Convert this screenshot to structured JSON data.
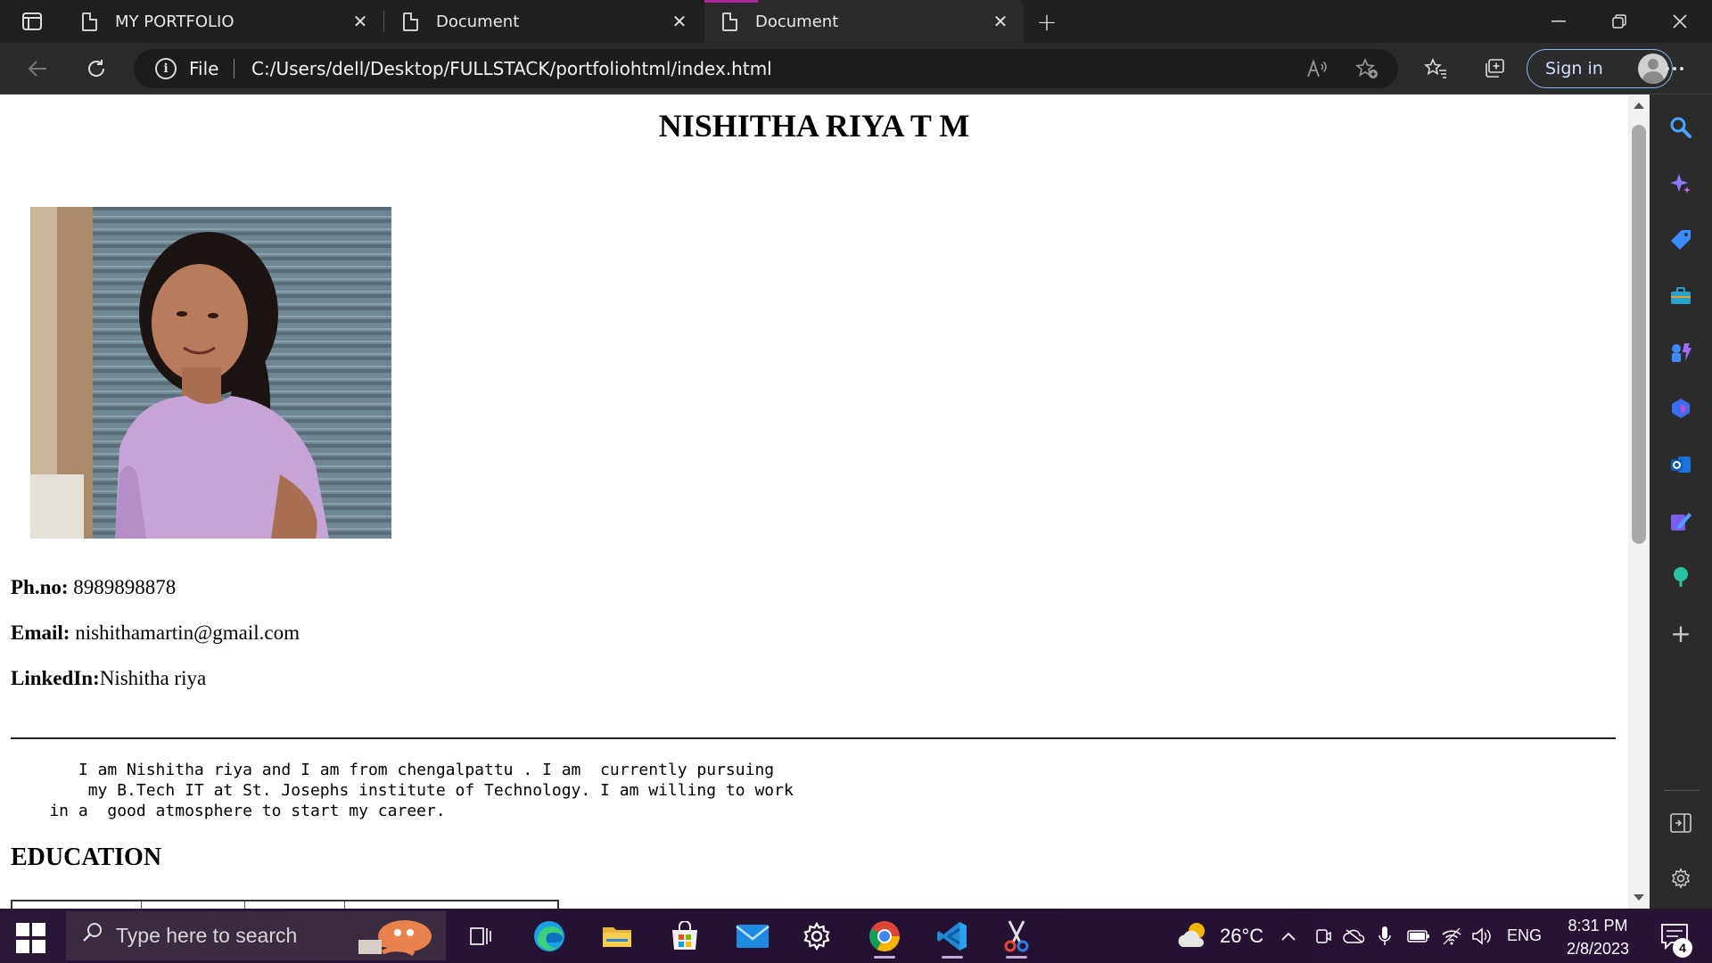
{
  "browser": {
    "tabs": [
      {
        "label": "MY PORTFOLIO",
        "active": false
      },
      {
        "label": "Document",
        "active": false
      },
      {
        "label": "Document",
        "active": true
      }
    ],
    "address": {
      "scheme_label": "File",
      "url": "C:/Users/dell/Desktop/FULLSTACK/portfoliohtml/index.html"
    },
    "signin_label": "Sign in"
  },
  "page": {
    "title": "NISHITHA RIYA T M",
    "contact": {
      "phone_label": "Ph.no:",
      "phone_value": " 8989898878",
      "email_label": "Email:",
      "email_value": " nishithamartin@gmail.com",
      "linkedin_label": "LinkedIn:",
      "linkedin_value": "Nishitha riya"
    },
    "about": "       I am Nishitha riya and I am from chengalpattu . I am  currently pursuing\n        my B.Tech IT at St. Josephs institute of Technology. I am willing to work\n    in a  good atmosphere to start my career.",
    "education_heading": "EDUCATION"
  },
  "taskbar": {
    "search_placeholder": "Type here to search",
    "weather": "26°C",
    "language": "ENG",
    "time": "8:31 PM",
    "date": "2/8/2023",
    "notification_count": "4"
  },
  "colors": {
    "accent": "#b0269f",
    "signin_border": "#8ab4f8"
  }
}
